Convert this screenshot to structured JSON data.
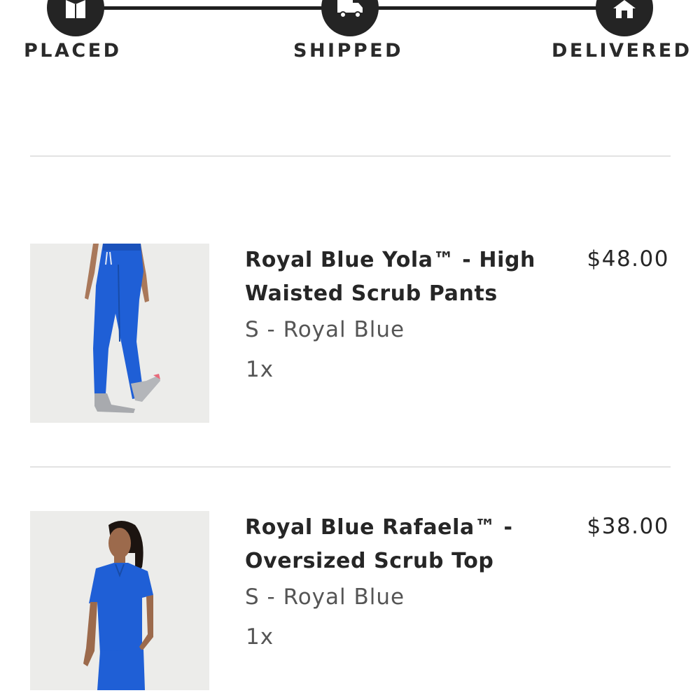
{
  "tracker": {
    "steps": [
      {
        "label": "PLACED",
        "icon": "box-icon"
      },
      {
        "label": "SHIPPED",
        "icon": "truck-icon"
      },
      {
        "label": "DELIVERED",
        "icon": "house-icon"
      }
    ]
  },
  "items": [
    {
      "name": "Royal Blue Yola™ - High Waisted Scrub Pants",
      "variant": "S - Royal Blue",
      "quantity": "1x",
      "price": "$48.00",
      "image": "scrub-pants-photo"
    },
    {
      "name": "Royal Blue Rafaela™ - Oversized Scrub Top",
      "variant": "S - Royal Blue",
      "quantity": "1x",
      "price": "$38.00",
      "image": "scrub-top-photo"
    }
  ],
  "colors": {
    "product": "#1f5fd6",
    "tracker": "#242424",
    "divider": "#e3e3e3"
  }
}
